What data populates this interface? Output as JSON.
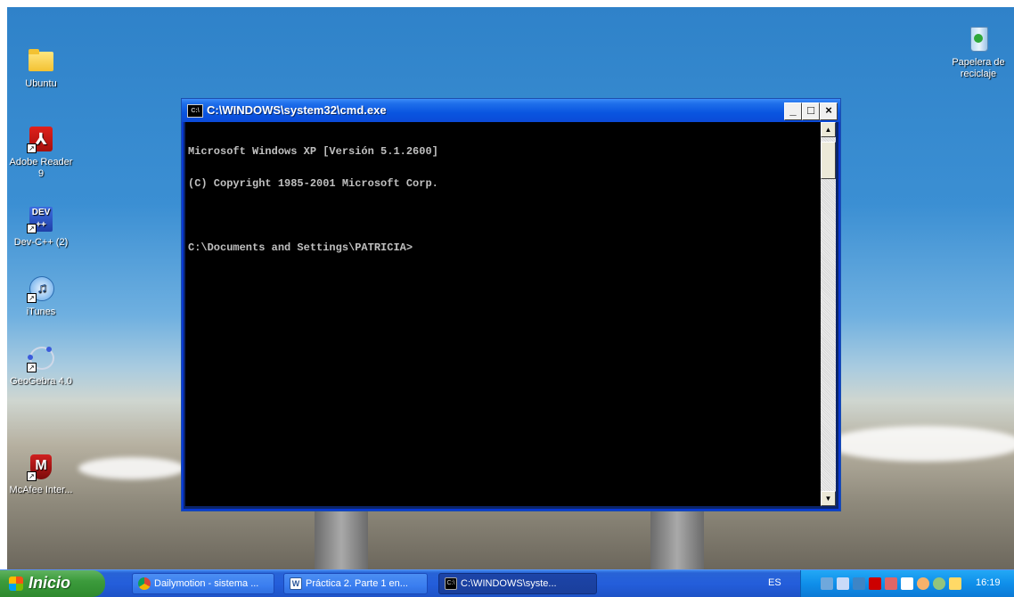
{
  "desktop": {
    "icons": [
      {
        "label": "Ubuntu"
      },
      {
        "label": "Adobe Reader 9"
      },
      {
        "label": "Dev-C++ (2)"
      },
      {
        "label": "iTunes"
      },
      {
        "label": "GeoGebra 4.0"
      },
      {
        "label": "McAfee Inter..."
      },
      {
        "label": "Papelera de reciclaje"
      }
    ]
  },
  "cmd": {
    "title": "C:\\WINDOWS\\system32\\cmd.exe",
    "lines": [
      "Microsoft Windows XP [Versión 5.1.2600]",
      "(C) Copyright 1985-2001 Microsoft Corp.",
      "",
      "C:\\Documents and Settings\\PATRICIA>"
    ],
    "buttons": {
      "minimize": "_",
      "maximize": "□",
      "close": "×"
    }
  },
  "taskbar": {
    "start_label": "Inicio",
    "tasks": [
      {
        "label": "Dailymotion - sistema ..."
      },
      {
        "label": "Práctica 2. Parte 1 en..."
      },
      {
        "label": "C:\\WINDOWS\\syste..."
      }
    ],
    "language": "ES",
    "clock": "16:19"
  },
  "colors": {
    "taskbar": "#245edb",
    "start": "#3c9b3c",
    "titlebar": "#0a55e0",
    "console_bg": "#000000",
    "console_fg": "#c0c0c0"
  }
}
